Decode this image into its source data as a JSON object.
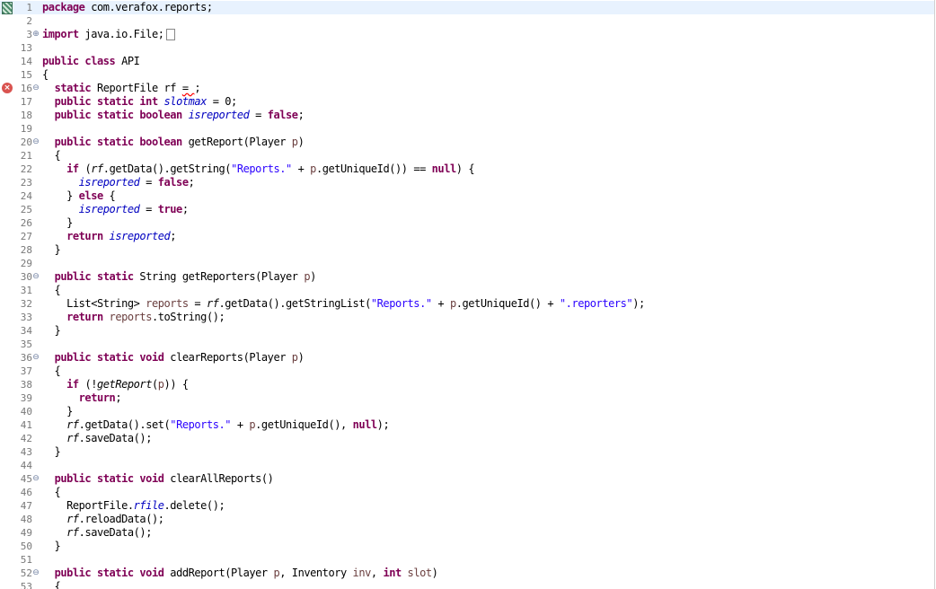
{
  "editor": {
    "language": "java",
    "lines": [
      {
        "n": "1",
        "fold": "",
        "marker": "bookmark",
        "current": true,
        "tokens": [
          [
            "kw",
            "package"
          ],
          [
            "t",
            " com.verafox.reports;"
          ]
        ]
      },
      {
        "n": "2",
        "fold": "",
        "tokens": []
      },
      {
        "n": "3",
        "fold": "+",
        "tokens": [
          [
            "kw",
            "import"
          ],
          [
            "t",
            " java.io.File;"
          ],
          [
            "box",
            "□"
          ]
        ]
      },
      {
        "n": "13",
        "fold": "",
        "tokens": []
      },
      {
        "n": "14",
        "fold": "",
        "tokens": [
          [
            "kw",
            "public class"
          ],
          [
            "t",
            " API"
          ]
        ]
      },
      {
        "n": "15",
        "fold": "",
        "tokens": [
          [
            "t",
            "{"
          ]
        ]
      },
      {
        "n": "16",
        "fold": "-",
        "marker": "error",
        "tokens": [
          [
            "t",
            "  "
          ],
          [
            "kw",
            "static"
          ],
          [
            "t",
            " ReportFile rf "
          ],
          [
            "err",
            "= "
          ],
          [
            "t",
            ";"
          ]
        ]
      },
      {
        "n": "17",
        "fold": "",
        "tokens": [
          [
            "t",
            "  "
          ],
          [
            "kw",
            "public static int"
          ],
          [
            "t",
            " "
          ],
          [
            "fld",
            "slotmax"
          ],
          [
            "t",
            " = 0;"
          ]
        ]
      },
      {
        "n": "18",
        "fold": "",
        "tokens": [
          [
            "t",
            "  "
          ],
          [
            "kw",
            "public static boolean"
          ],
          [
            "t",
            " "
          ],
          [
            "fld",
            "isreported"
          ],
          [
            "t",
            " = "
          ],
          [
            "kw",
            "false"
          ],
          [
            "t",
            ";"
          ]
        ]
      },
      {
        "n": "19",
        "fold": "",
        "tokens": []
      },
      {
        "n": "20",
        "fold": "-",
        "tokens": [
          [
            "t",
            "  "
          ],
          [
            "kw",
            "public static boolean"
          ],
          [
            "t",
            " getReport(Player "
          ],
          [
            "var",
            "p"
          ],
          [
            "t",
            ")"
          ]
        ]
      },
      {
        "n": "21",
        "fold": "",
        "tokens": [
          [
            "t",
            "  {"
          ]
        ]
      },
      {
        "n": "22",
        "fold": "",
        "tokens": [
          [
            "t",
            "    "
          ],
          [
            "kw",
            "if"
          ],
          [
            "t",
            " ("
          ],
          [
            "mth",
            "rf"
          ],
          [
            "t",
            ".getData().getString("
          ],
          [
            "str",
            "\"Reports.\""
          ],
          [
            "t",
            " + "
          ],
          [
            "var",
            "p"
          ],
          [
            "t",
            ".getUniqueId()) == "
          ],
          [
            "kw",
            "null"
          ],
          [
            "t",
            ") {"
          ]
        ]
      },
      {
        "n": "23",
        "fold": "",
        "tokens": [
          [
            "t",
            "      "
          ],
          [
            "fld",
            "isreported"
          ],
          [
            "t",
            " = "
          ],
          [
            "kw",
            "false"
          ],
          [
            "t",
            ";"
          ]
        ]
      },
      {
        "n": "24",
        "fold": "",
        "tokens": [
          [
            "t",
            "    } "
          ],
          [
            "kw",
            "else"
          ],
          [
            "t",
            " {"
          ]
        ]
      },
      {
        "n": "25",
        "fold": "",
        "tokens": [
          [
            "t",
            "      "
          ],
          [
            "fld",
            "isreported"
          ],
          [
            "t",
            " = "
          ],
          [
            "kw",
            "true"
          ],
          [
            "t",
            ";"
          ]
        ]
      },
      {
        "n": "26",
        "fold": "",
        "tokens": [
          [
            "t",
            "    }"
          ]
        ]
      },
      {
        "n": "27",
        "fold": "",
        "tokens": [
          [
            "t",
            "    "
          ],
          [
            "kw",
            "return"
          ],
          [
            "t",
            " "
          ],
          [
            "fld",
            "isreported"
          ],
          [
            "t",
            ";"
          ]
        ]
      },
      {
        "n": "28",
        "fold": "",
        "tokens": [
          [
            "t",
            "  }"
          ]
        ]
      },
      {
        "n": "29",
        "fold": "",
        "tokens": []
      },
      {
        "n": "30",
        "fold": "-",
        "tokens": [
          [
            "t",
            "  "
          ],
          [
            "kw",
            "public static"
          ],
          [
            "t",
            " String getReporters(Player "
          ],
          [
            "var",
            "p"
          ],
          [
            "t",
            ")"
          ]
        ]
      },
      {
        "n": "31",
        "fold": "",
        "tokens": [
          [
            "t",
            "  {"
          ]
        ]
      },
      {
        "n": "32",
        "fold": "",
        "tokens": [
          [
            "t",
            "    List<String> "
          ],
          [
            "var",
            "reports"
          ],
          [
            "t",
            " = "
          ],
          [
            "mth",
            "rf"
          ],
          [
            "t",
            ".getData().getStringList("
          ],
          [
            "str",
            "\"Reports.\""
          ],
          [
            "t",
            " + "
          ],
          [
            "var",
            "p"
          ],
          [
            "t",
            ".getUniqueId() + "
          ],
          [
            "str",
            "\".reporters\""
          ],
          [
            "t",
            ");"
          ]
        ]
      },
      {
        "n": "33",
        "fold": "",
        "tokens": [
          [
            "t",
            "    "
          ],
          [
            "kw",
            "return"
          ],
          [
            "t",
            " "
          ],
          [
            "var",
            "reports"
          ],
          [
            "t",
            ".toString();"
          ]
        ]
      },
      {
        "n": "34",
        "fold": "",
        "tokens": [
          [
            "t",
            "  }"
          ]
        ]
      },
      {
        "n": "35",
        "fold": "",
        "tokens": []
      },
      {
        "n": "36",
        "fold": "-",
        "tokens": [
          [
            "t",
            "  "
          ],
          [
            "kw",
            "public static void"
          ],
          [
            "t",
            " clearReports(Player "
          ],
          [
            "var",
            "p"
          ],
          [
            "t",
            ")"
          ]
        ]
      },
      {
        "n": "37",
        "fold": "",
        "tokens": [
          [
            "t",
            "  {"
          ]
        ]
      },
      {
        "n": "38",
        "fold": "",
        "tokens": [
          [
            "t",
            "    "
          ],
          [
            "kw",
            "if"
          ],
          [
            "t",
            " (!"
          ],
          [
            "mth",
            "getReport"
          ],
          [
            "t",
            "("
          ],
          [
            "var",
            "p"
          ],
          [
            "t",
            ")) {"
          ]
        ]
      },
      {
        "n": "39",
        "fold": "",
        "tokens": [
          [
            "t",
            "      "
          ],
          [
            "kw",
            "return"
          ],
          [
            "t",
            ";"
          ]
        ]
      },
      {
        "n": "40",
        "fold": "",
        "tokens": [
          [
            "t",
            "    }"
          ]
        ]
      },
      {
        "n": "41",
        "fold": "",
        "tokens": [
          [
            "t",
            "    "
          ],
          [
            "mth",
            "rf"
          ],
          [
            "t",
            ".getData().set("
          ],
          [
            "str",
            "\"Reports.\""
          ],
          [
            "t",
            " + "
          ],
          [
            "var",
            "p"
          ],
          [
            "t",
            ".getUniqueId(), "
          ],
          [
            "kw",
            "null"
          ],
          [
            "t",
            ");"
          ]
        ]
      },
      {
        "n": "42",
        "fold": "",
        "tokens": [
          [
            "t",
            "    "
          ],
          [
            "mth",
            "rf"
          ],
          [
            "t",
            ".saveData();"
          ]
        ]
      },
      {
        "n": "43",
        "fold": "",
        "tokens": [
          [
            "t",
            "  }"
          ]
        ]
      },
      {
        "n": "44",
        "fold": "",
        "tokens": []
      },
      {
        "n": "45",
        "fold": "-",
        "tokens": [
          [
            "t",
            "  "
          ],
          [
            "kw",
            "public static void"
          ],
          [
            "t",
            " clearAllReports()"
          ]
        ]
      },
      {
        "n": "46",
        "fold": "",
        "tokens": [
          [
            "t",
            "  {"
          ]
        ]
      },
      {
        "n": "47",
        "fold": "",
        "tokens": [
          [
            "t",
            "    ReportFile."
          ],
          [
            "fld",
            "rfile"
          ],
          [
            "t",
            ".delete();"
          ]
        ]
      },
      {
        "n": "48",
        "fold": "",
        "tokens": [
          [
            "t",
            "    "
          ],
          [
            "mth",
            "rf"
          ],
          [
            "t",
            ".reloadData();"
          ]
        ]
      },
      {
        "n": "49",
        "fold": "",
        "tokens": [
          [
            "t",
            "    "
          ],
          [
            "mth",
            "rf"
          ],
          [
            "t",
            ".saveData();"
          ]
        ]
      },
      {
        "n": "50",
        "fold": "",
        "tokens": [
          [
            "t",
            "  }"
          ]
        ]
      },
      {
        "n": "51",
        "fold": "",
        "tokens": []
      },
      {
        "n": "52",
        "fold": "-",
        "tokens": [
          [
            "t",
            "  "
          ],
          [
            "kw",
            "public static void"
          ],
          [
            "t",
            " addReport(Player "
          ],
          [
            "var",
            "p"
          ],
          [
            "t",
            ", Inventory "
          ],
          [
            "var",
            "inv"
          ],
          [
            "t",
            ", "
          ],
          [
            "kw",
            "int"
          ],
          [
            "t",
            " "
          ],
          [
            "var",
            "slot"
          ],
          [
            "t",
            ")"
          ]
        ]
      },
      {
        "n": "53",
        "fold": "",
        "tokens": [
          [
            "t",
            "  {"
          ]
        ]
      }
    ]
  }
}
